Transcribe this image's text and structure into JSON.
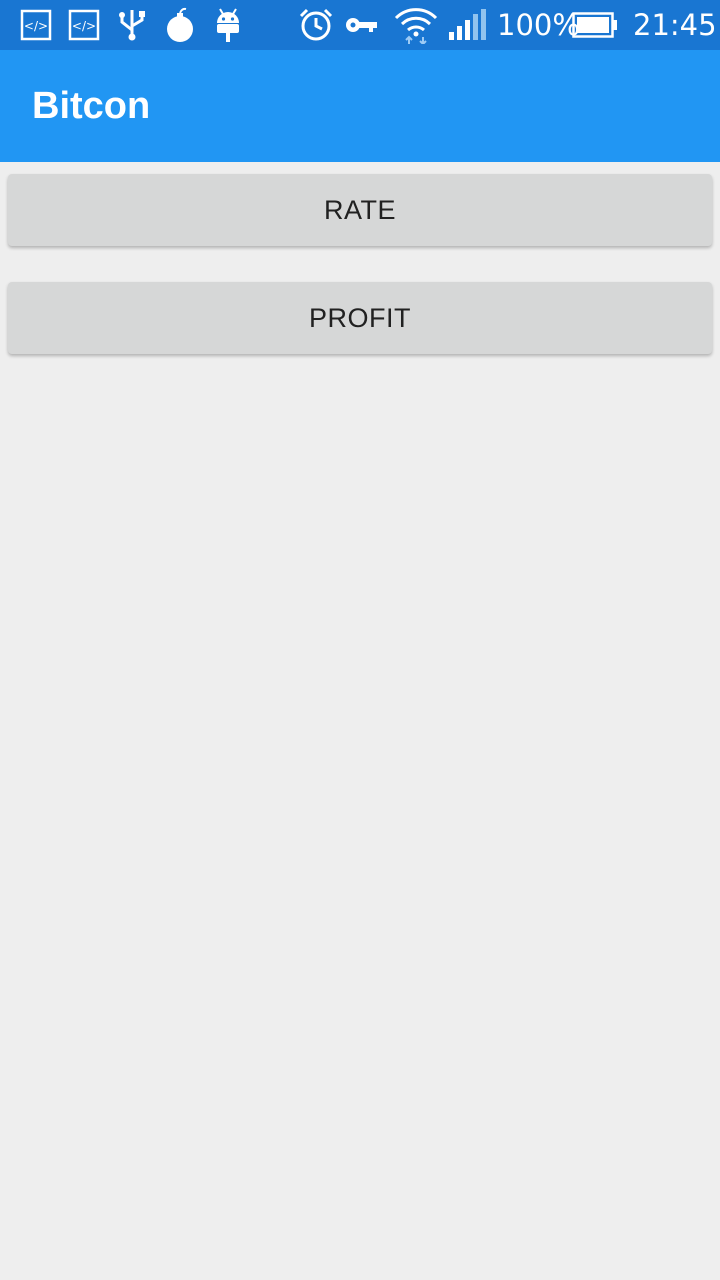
{
  "status_bar": {
    "icons": [
      "code-icon",
      "code-icon",
      "usb-icon",
      "bomb-icon",
      "android-icon",
      "alarm-icon",
      "key-icon",
      "wifi-icon",
      "signal-icon",
      "battery-icon"
    ],
    "battery": "100%",
    "time": "21:45"
  },
  "app_bar": {
    "title": "Bitcon"
  },
  "buttons": {
    "rate": "RATE",
    "profit": "PROFIT"
  },
  "colors": {
    "status_bar": "#1976d2",
    "app_bar": "#2196f3",
    "background": "#eeeeee",
    "button": "#d6d7d7"
  }
}
